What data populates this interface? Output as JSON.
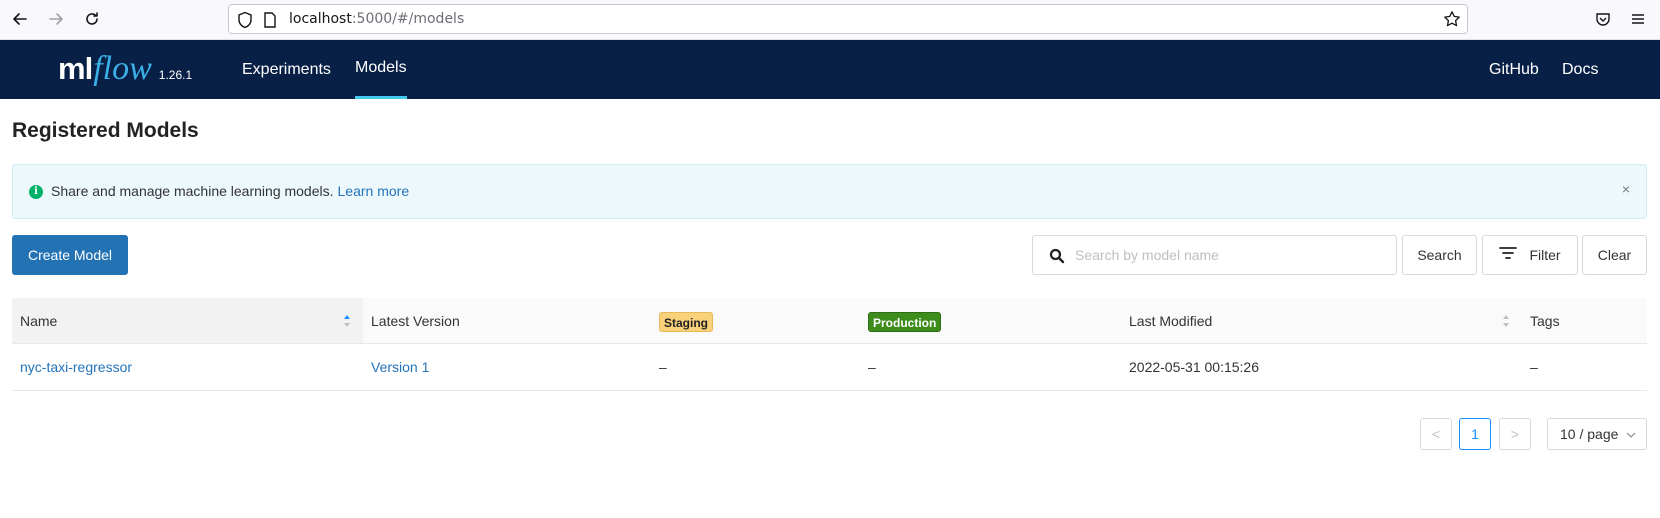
{
  "browser": {
    "url_host": "localhost",
    "url_rest": ":5000/#/models"
  },
  "header": {
    "logo_ml": "ml",
    "logo_flow": "flow",
    "version": "1.26.1",
    "nav": [
      "Experiments",
      "Models"
    ],
    "active_nav": "Models",
    "right_links": [
      "GitHub",
      "Docs"
    ]
  },
  "page": {
    "title": "Registered Models",
    "alert": {
      "message": "Share and manage machine learning models.",
      "link": "Learn more",
      "close": "×"
    },
    "create_label": "Create Model",
    "search_placeholder": "Search by model name",
    "search_label": "Search",
    "filter_label": "Filter",
    "clear_label": "Clear"
  },
  "table": {
    "columns": {
      "name": "Name",
      "latest_version": "Latest Version",
      "staging": "Staging",
      "production": "Production",
      "last_modified": "Last Modified",
      "tags": "Tags"
    },
    "rows": [
      {
        "name": "nyc-taxi-regressor",
        "latest_version": "Version 1",
        "staging": "–",
        "production": "–",
        "last_modified": "2022-05-31 00:15:26",
        "tags": "–"
      }
    ]
  },
  "pagination": {
    "prev": "<",
    "current": "1",
    "next": ">",
    "page_size": "10 / page"
  },
  "colors": {
    "header_bg": "#082046",
    "primary": "#2272b4",
    "link": "#2374bb",
    "staging": "#fad17b",
    "production": "#3e8c1c"
  }
}
